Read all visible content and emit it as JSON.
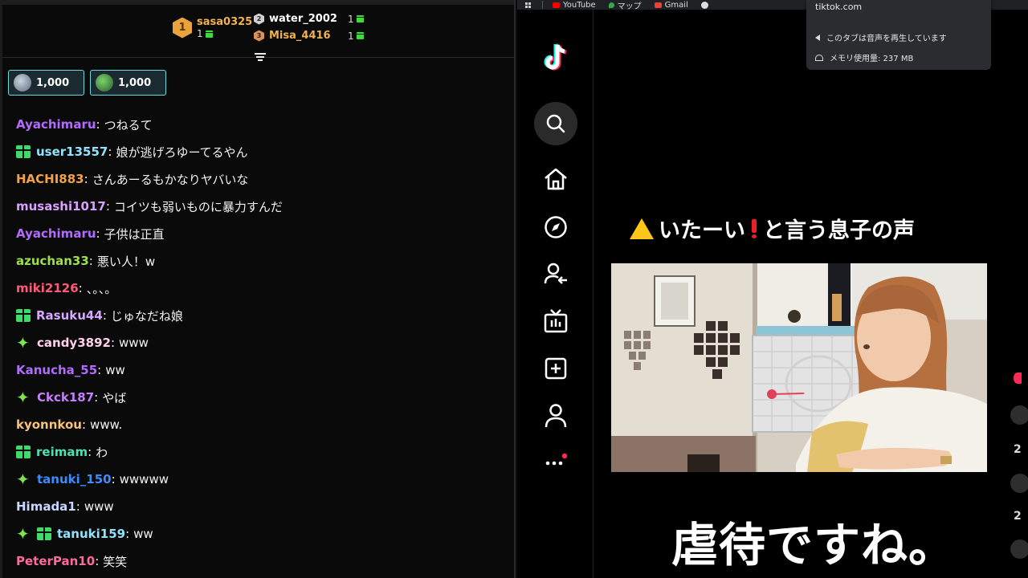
{
  "leaderboard": [
    {
      "rank": "1",
      "name": "sasa0325",
      "count": "1",
      "color": "#f0b24a"
    },
    {
      "rank": "2",
      "name": "water_2002",
      "count": "1",
      "color": "#ffffff"
    },
    {
      "rank": "3",
      "name": "Misa_4416",
      "count": "1",
      "color": "#f0b24a"
    }
  ],
  "coin_badges": [
    {
      "value": "1,000"
    },
    {
      "value": "1,000"
    }
  ],
  "messages": [
    {
      "user": "Ayachimaru",
      "text": "つねるて",
      "color": "#b36bff",
      "badges": []
    },
    {
      "user": "user13557",
      "text": "娘が逃げろゆーてるやん",
      "color": "#8fe3ff",
      "badges": [
        "gift"
      ]
    },
    {
      "user": "HACHI883",
      "text": "さんあーるもかなりヤバいな",
      "color": "#f5a145",
      "badges": []
    },
    {
      "user": "musashi1017",
      "text": "コイツも弱いものに暴力すんだ",
      "color": "#d9a0ff",
      "badges": []
    },
    {
      "user": "Ayachimaru",
      "text": "子供は正直",
      "color": "#b36bff",
      "badges": []
    },
    {
      "user": "azuchan33",
      "text": "悪い人！w",
      "color": "#9de04d",
      "badges": []
    },
    {
      "user": "miki2126",
      "text": "、。、。",
      "color": "#ff5a7a",
      "badges": []
    },
    {
      "user": "Rasuku44",
      "text": "じゅなだね娘",
      "color": "#d7a8ff",
      "badges": [
        "gift"
      ]
    },
    {
      "user": "candy3892",
      "text": "www",
      "color": "#ffd1e8",
      "badges": [
        "spark"
      ]
    },
    {
      "user": "Kanucha_55",
      "text": "ww",
      "color": "#b36bff",
      "badges": []
    },
    {
      "user": "Ckck187",
      "text": "やば",
      "color": "#c77dff",
      "badges": [
        "spark"
      ]
    },
    {
      "user": "kyonnkou",
      "text": "www.",
      "color": "#f7c27a",
      "badges": []
    },
    {
      "user": "reimam",
      "text": "わ",
      "color": "#4fe0b0",
      "badges": [
        "gift"
      ]
    },
    {
      "user": "tanuki_150",
      "text": "wwwww",
      "color": "#3b8cff",
      "badges": [
        "spark"
      ]
    },
    {
      "user": "Himada1",
      "text": "www",
      "color": "#c9d8ff",
      "badges": []
    },
    {
      "user": "tanuki159",
      "text": "ww",
      "color": "#8fe3ff",
      "badges": [
        "spark",
        "gift"
      ]
    },
    {
      "user": "PeterPan10",
      "text": "笑笑",
      "color": "#ff6a9a",
      "badges": []
    }
  ],
  "bookmarks": [
    {
      "label": "YouTube",
      "color": "#ff0000"
    },
    {
      "label": "マップ",
      "color": "#34a853"
    },
    {
      "label": "Gmail",
      "color": "#ea4335"
    }
  ],
  "tooltip": {
    "domain": "tiktok.com",
    "audio": "このタブは音声を再生しています",
    "memory": "メモリ使用量: 237 MB"
  },
  "video": {
    "caption_top": "いたーい",
    "caption_top_2": "と言う息子の声",
    "caption_bottom": "虐待ですね。"
  },
  "side_counts": [
    "2",
    "2"
  ]
}
